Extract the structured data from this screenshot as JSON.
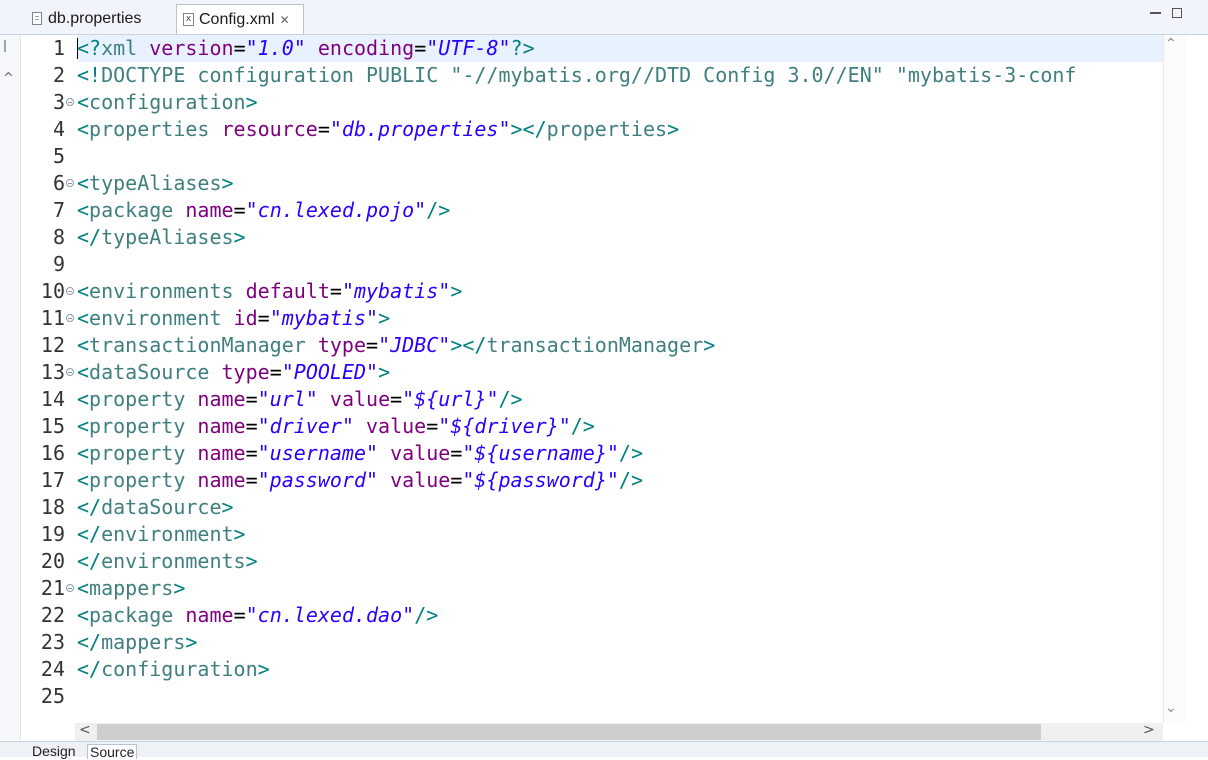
{
  "tabs": [
    {
      "label": "db.properties",
      "icon": "properties-file-icon"
    },
    {
      "label": "Config.xml",
      "icon": "xml-file-icon",
      "active": true,
      "close": "✕"
    }
  ],
  "editor": {
    "lines": [
      {
        "n": "1",
        "tokens": [
          [
            "k",
            "<?"
          ],
          [
            "n",
            "xml"
          ],
          [
            "t",
            " "
          ],
          [
            "a",
            "version"
          ],
          [
            "eq",
            "="
          ],
          [
            "v",
            "\"1.0\""
          ],
          [
            "t",
            " "
          ],
          [
            "a",
            "encoding"
          ],
          [
            "eq",
            "="
          ],
          [
            "v",
            "\"UTF-8\""
          ],
          [
            "k",
            "?>"
          ]
        ]
      },
      {
        "n": "2",
        "tokens": [
          [
            "k",
            "<!"
          ],
          [
            "n",
            "DOCTYPE configuration"
          ],
          [
            "t",
            " "
          ],
          [
            "dt",
            "PUBLIC"
          ],
          [
            "t",
            " "
          ],
          [
            "n",
            "\"-//mybatis.org//DTD Config 3.0//EN\""
          ],
          [
            "t",
            " "
          ],
          [
            "n",
            "\"mybatis-3-conf"
          ]
        ]
      },
      {
        "n": "3",
        "fold": true,
        "tokens": [
          [
            "k",
            "<"
          ],
          [
            "n",
            "configuration"
          ],
          [
            "k",
            ">"
          ]
        ]
      },
      {
        "n": "4",
        "tokens": [
          [
            "k",
            "<"
          ],
          [
            "n",
            "properties"
          ],
          [
            "t",
            " "
          ],
          [
            "a",
            "resource"
          ],
          [
            "eq",
            "="
          ],
          [
            "v",
            "\"db.properties\""
          ],
          [
            "k",
            "></"
          ],
          [
            "n",
            "properties"
          ],
          [
            "k",
            ">"
          ]
        ]
      },
      {
        "n": "5",
        "tokens": []
      },
      {
        "n": "6",
        "fold": true,
        "tokens": [
          [
            "k",
            "<"
          ],
          [
            "n",
            "typeAliases"
          ],
          [
            "k",
            ">"
          ]
        ]
      },
      {
        "n": "7",
        "tokens": [
          [
            "k",
            "<"
          ],
          [
            "n",
            "package"
          ],
          [
            "t",
            " "
          ],
          [
            "a",
            "name"
          ],
          [
            "eq",
            "="
          ],
          [
            "v",
            "\"cn.lexed.pojo\""
          ],
          [
            "k",
            "/>"
          ]
        ]
      },
      {
        "n": "8",
        "tokens": [
          [
            "k",
            "</"
          ],
          [
            "n",
            "typeAliases"
          ],
          [
            "k",
            ">"
          ]
        ]
      },
      {
        "n": "9",
        "tokens": []
      },
      {
        "n": "10",
        "fold": true,
        "tokens": [
          [
            "k",
            "<"
          ],
          [
            "n",
            "environments"
          ],
          [
            "t",
            " "
          ],
          [
            "a",
            "default"
          ],
          [
            "eq",
            "="
          ],
          [
            "v",
            "\"mybatis\""
          ],
          [
            "k",
            ">"
          ]
        ]
      },
      {
        "n": "11",
        "fold": true,
        "tokens": [
          [
            "k",
            "<"
          ],
          [
            "n",
            "environment"
          ],
          [
            "t",
            " "
          ],
          [
            "a",
            "id"
          ],
          [
            "eq",
            "="
          ],
          [
            "v",
            "\"mybatis\""
          ],
          [
            "k",
            ">"
          ]
        ]
      },
      {
        "n": "12",
        "tokens": [
          [
            "k",
            "<"
          ],
          [
            "n",
            "transactionManager"
          ],
          [
            "t",
            " "
          ],
          [
            "a",
            "type"
          ],
          [
            "eq",
            "="
          ],
          [
            "v",
            "\"JDBC\""
          ],
          [
            "k",
            "></"
          ],
          [
            "n",
            "transactionManager"
          ],
          [
            "k",
            ">"
          ]
        ]
      },
      {
        "n": "13",
        "fold": true,
        "tokens": [
          [
            "k",
            "<"
          ],
          [
            "n",
            "dataSource"
          ],
          [
            "t",
            " "
          ],
          [
            "a",
            "type"
          ],
          [
            "eq",
            "="
          ],
          [
            "v",
            "\"POOLED\""
          ],
          [
            "k",
            ">"
          ]
        ]
      },
      {
        "n": "14",
        "tokens": [
          [
            "k",
            "<"
          ],
          [
            "n",
            "property"
          ],
          [
            "t",
            " "
          ],
          [
            "a",
            "name"
          ],
          [
            "eq",
            "="
          ],
          [
            "v",
            "\"url\""
          ],
          [
            "t",
            " "
          ],
          [
            "a",
            "value"
          ],
          [
            "eq",
            "="
          ],
          [
            "v",
            "\"${url}\""
          ],
          [
            "k",
            "/>"
          ]
        ]
      },
      {
        "n": "15",
        "tokens": [
          [
            "k",
            "<"
          ],
          [
            "n",
            "property"
          ],
          [
            "t",
            " "
          ],
          [
            "a",
            "name"
          ],
          [
            "eq",
            "="
          ],
          [
            "v",
            "\"driver\""
          ],
          [
            "t",
            " "
          ],
          [
            "a",
            "value"
          ],
          [
            "eq",
            "="
          ],
          [
            "v",
            "\"${driver}\""
          ],
          [
            "k",
            "/>"
          ]
        ]
      },
      {
        "n": "16",
        "tokens": [
          [
            "k",
            "<"
          ],
          [
            "n",
            "property"
          ],
          [
            "t",
            " "
          ],
          [
            "a",
            "name"
          ],
          [
            "eq",
            "="
          ],
          [
            "v",
            "\"username\""
          ],
          [
            "t",
            " "
          ],
          [
            "a",
            "value"
          ],
          [
            "eq",
            "="
          ],
          [
            "v",
            "\"${username}\""
          ],
          [
            "k",
            "/>"
          ]
        ]
      },
      {
        "n": "17",
        "tokens": [
          [
            "k",
            "<"
          ],
          [
            "n",
            "property"
          ],
          [
            "t",
            " "
          ],
          [
            "a",
            "name"
          ],
          [
            "eq",
            "="
          ],
          [
            "v",
            "\"password\""
          ],
          [
            "t",
            " "
          ],
          [
            "a",
            "value"
          ],
          [
            "eq",
            "="
          ],
          [
            "v",
            "\"${password}\""
          ],
          [
            "k",
            "/>"
          ]
        ]
      },
      {
        "n": "18",
        "tokens": [
          [
            "k",
            "</"
          ],
          [
            "n",
            "dataSource"
          ],
          [
            "k",
            ">"
          ]
        ]
      },
      {
        "n": "19",
        "tokens": [
          [
            "k",
            "</"
          ],
          [
            "n",
            "environment"
          ],
          [
            "k",
            ">"
          ]
        ]
      },
      {
        "n": "20",
        "tokens": [
          [
            "k",
            "</"
          ],
          [
            "n",
            "environments"
          ],
          [
            "k",
            ">"
          ]
        ]
      },
      {
        "n": "21",
        "fold": true,
        "tokens": [
          [
            "k",
            "<"
          ],
          [
            "n",
            "mappers"
          ],
          [
            "k",
            ">"
          ]
        ]
      },
      {
        "n": "22",
        "tokens": [
          [
            "k",
            "<"
          ],
          [
            "n",
            "package"
          ],
          [
            "t",
            " "
          ],
          [
            "a",
            "name"
          ],
          [
            "eq",
            "="
          ],
          [
            "v",
            "\"cn.lexed.dao\""
          ],
          [
            "k",
            "/>"
          ]
        ]
      },
      {
        "n": "23",
        "tokens": [
          [
            "k",
            "</"
          ],
          [
            "n",
            "mappers"
          ],
          [
            "k",
            ">"
          ]
        ]
      },
      {
        "n": "24",
        "tokens": [
          [
            "k",
            "</"
          ],
          [
            "n",
            "configuration"
          ],
          [
            "k",
            ">"
          ]
        ]
      },
      {
        "n": "25",
        "tokens": []
      }
    ]
  },
  "bottom_tabs": {
    "design": "Design",
    "source": "Source"
  },
  "colors": {
    "tag": "#008080",
    "attr": "#7f007f",
    "value": "#2a00ff",
    "current_line": "#e8f2fe"
  }
}
